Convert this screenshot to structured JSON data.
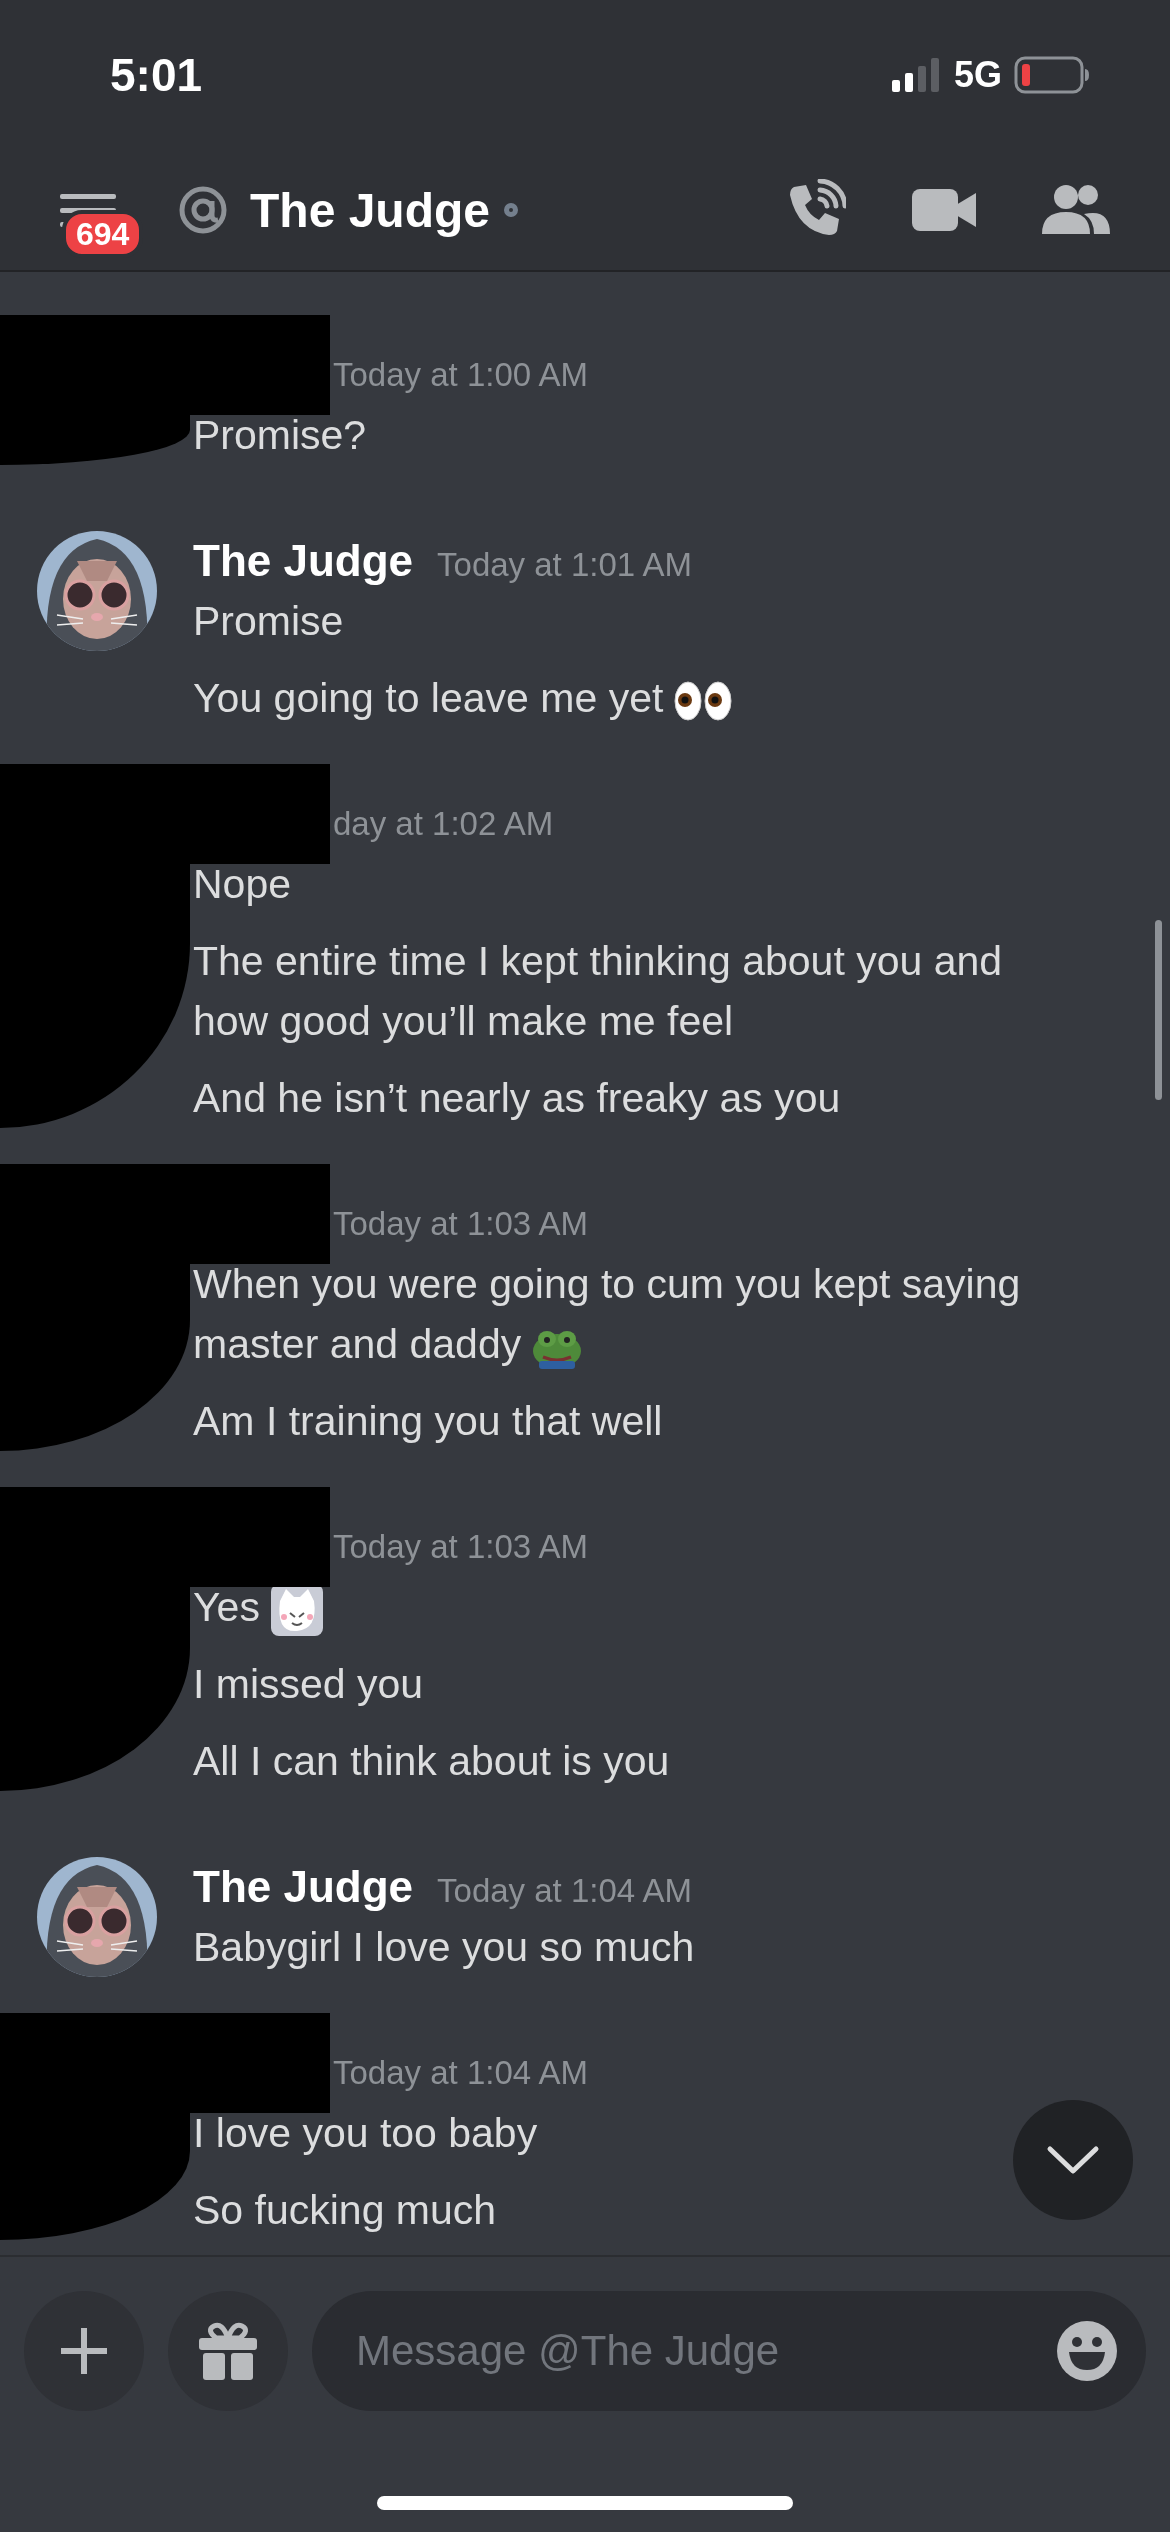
{
  "status_bar": {
    "time": "5:01",
    "network": "5G"
  },
  "header": {
    "unread_badge": "694",
    "title": "The Judge",
    "online": false
  },
  "messages": [
    {
      "redacted": true,
      "timestamp": "Today at 1:00 AM",
      "lines": [
        {
          "kind": "text",
          "text": "Promise?"
        }
      ]
    },
    {
      "redacted": false,
      "author": "The Judge",
      "avatar": {
        "kind": "picture"
      },
      "timestamp": "Today at 1:01 AM",
      "lines": [
        {
          "kind": "text",
          "text": "Promise"
        },
        {
          "kind": "eyes",
          "text": "You going to leave me yet"
        }
      ]
    },
    {
      "redacted": true,
      "timestamp": "day at 1:02 AM",
      "lines": [
        {
          "kind": "text",
          "text": "Nope"
        },
        {
          "kind": "text",
          "text": "The entire time I kept thinking about you and how good you’ll make me feel"
        },
        {
          "kind": "text",
          "text": "And he isn’t nearly as freaky as you"
        }
      ]
    },
    {
      "redacted": true,
      "timestamp": "Today at 1:03 AM",
      "lines": [
        {
          "kind": "frog",
          "text": "When you were going to cum you kept saying master and daddy"
        },
        {
          "kind": "text",
          "text": "Am I training you that well"
        }
      ]
    },
    {
      "redacted": true,
      "timestamp": "Today at 1:03 AM",
      "lines": [
        {
          "kind": "cat",
          "text": "Yes"
        },
        {
          "kind": "text",
          "text": "I missed you"
        },
        {
          "kind": "text",
          "text": "All I can think about is you"
        }
      ]
    },
    {
      "redacted": false,
      "author": "The Judge",
      "avatar": {
        "kind": "picture"
      },
      "timestamp": "Today at 1:04 AM",
      "lines": [
        {
          "kind": "text",
          "text": "Babygirl I love you so much"
        }
      ]
    },
    {
      "redacted": true,
      "timestamp": "Today at 1:04 AM",
      "lines": [
        {
          "kind": "text",
          "text": "I love you too baby"
        },
        {
          "kind": "text",
          "text": "So fucking much"
        }
      ]
    }
  ],
  "composer": {
    "placeholder": "Message @The Judge"
  }
}
